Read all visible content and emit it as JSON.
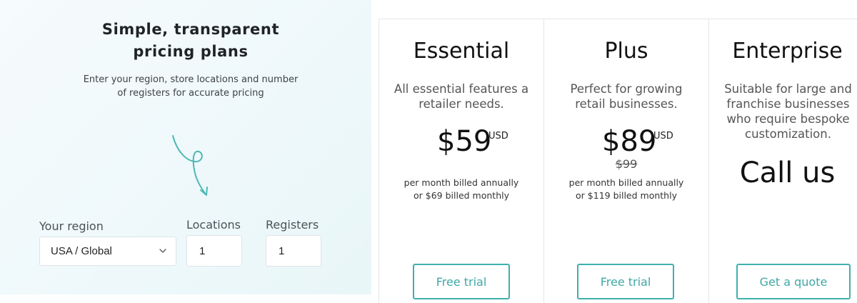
{
  "intro": {
    "headline_line1": "Simple, transparent",
    "headline_line2": "pricing plans",
    "subtext_line1": "Enter your region, store locations and number",
    "subtext_line2": "of registers for accurate pricing"
  },
  "form": {
    "region_label": "Your region",
    "region_value": "USA / Global",
    "locations_label": "Locations",
    "locations_value": "1",
    "registers_label": "Registers",
    "registers_value": "1"
  },
  "plans": [
    {
      "name": "Essential",
      "desc_line1": "All essential features a",
      "desc_line2": "retailer needs.",
      "price": "$59",
      "currency": "USD",
      "billing_line1": "per month billed annually",
      "billing_line2": "or $69 billed monthly",
      "cta": "Free trial"
    },
    {
      "name": "Plus",
      "desc_line1": "Perfect for growing",
      "desc_line2": "retail businesses.",
      "price": "$89",
      "currency": "USD",
      "old_price": "$99",
      "billing_line1": "per month billed annually",
      "billing_line2": "or $119 billed monthly",
      "cta": "Free trial"
    },
    {
      "name": "Enterprise",
      "desc_line1": "Suitable for large and",
      "desc_line2": "franchise businesses",
      "desc_line3": "who require bespoke",
      "desc_line4": "customization.",
      "price_text": "Call us",
      "cta": "Get a quote"
    }
  ],
  "colors": {
    "accent": "#3fb0ad",
    "panel_bg": "#eef8fa",
    "border": "#e3e6e8"
  },
  "icons": {
    "doodle": "curly-arrow-down-icon",
    "select": "chevron-down-icon"
  }
}
